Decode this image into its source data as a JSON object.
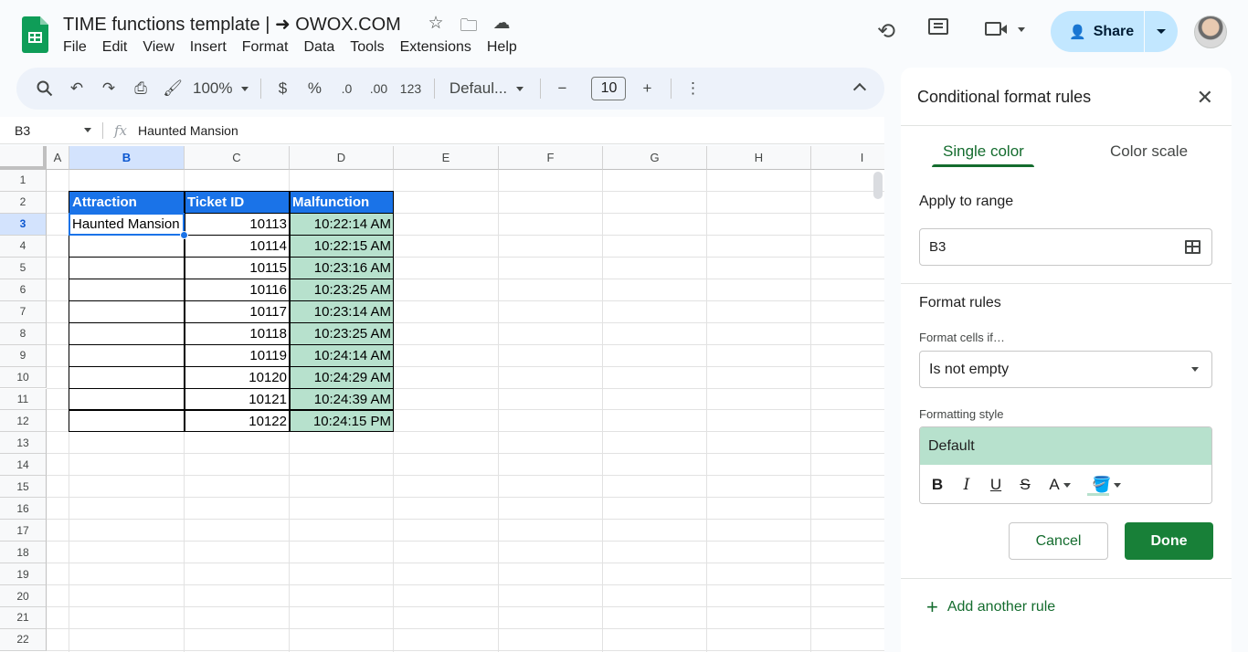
{
  "doc": {
    "title": "TIME functions template | ➜ OWOX.COM"
  },
  "menu": [
    "File",
    "Edit",
    "View",
    "Insert",
    "Format",
    "Data",
    "Tools",
    "Extensions",
    "Help"
  ],
  "share": {
    "label": "Share"
  },
  "toolbar": {
    "zoom": "100%",
    "currency": "$",
    "percent": "%",
    "dec_decrease": ".0",
    "dec_increase": ".00",
    "number_format": "123",
    "font": "Defaul...",
    "font_size": "10",
    "minus": "−",
    "plus": "+"
  },
  "formula_bar": {
    "cell_ref": "B3",
    "fx": "fx",
    "value": "Haunted Mansion"
  },
  "grid": {
    "columns": [
      "A",
      "B",
      "C",
      "D",
      "E",
      "F",
      "G",
      "H",
      "I"
    ],
    "rows": [
      "1",
      "2",
      "3",
      "4",
      "5",
      "6",
      "7",
      "8",
      "9",
      "10",
      "11",
      "12",
      "13",
      "14",
      "15",
      "16",
      "17",
      "18",
      "19",
      "20",
      "21",
      "22"
    ],
    "table": {
      "headers": [
        "Attraction",
        "Ticket ID",
        "Malfunction"
      ],
      "rows": [
        [
          "Haunted Mansion",
          "10113",
          "10:22:14 AM"
        ],
        [
          "",
          "10114",
          "10:22:15 AM"
        ],
        [
          "",
          "10115",
          "10:23:16 AM"
        ],
        [
          "",
          "10116",
          "10:23:25 AM"
        ],
        [
          "",
          "10117",
          "10:23:14 AM"
        ],
        [
          "",
          "10118",
          "10:23:25 AM"
        ],
        [
          "",
          "10119",
          "10:24:14 AM"
        ],
        [
          "",
          "10120",
          "10:24:29 AM"
        ],
        [
          "",
          "10121",
          "10:24:39 AM"
        ],
        [
          "",
          "10122",
          "10:24:15 PM"
        ]
      ]
    }
  },
  "panel": {
    "title": "Conditional format rules",
    "tabs": [
      "Single color",
      "Color scale"
    ],
    "apply_label": "Apply to range",
    "range_value": "B3",
    "rules_label": "Format rules",
    "cells_if_label": "Format cells if…",
    "condition": "Is not empty",
    "style_label": "Formatting style",
    "style_preview": "Default",
    "style_tools": {
      "bold": "B",
      "italic": "I",
      "underline": "U",
      "strike": "S",
      "text_color": "A"
    },
    "cancel": "Cancel",
    "done": "Done",
    "add_rule": "Add another rule"
  },
  "colors": {
    "accent": "#146c2e",
    "header_fill": "#1a73e8",
    "rule_fill": "#b7e1cd",
    "share_bg": "#c2e7ff"
  }
}
